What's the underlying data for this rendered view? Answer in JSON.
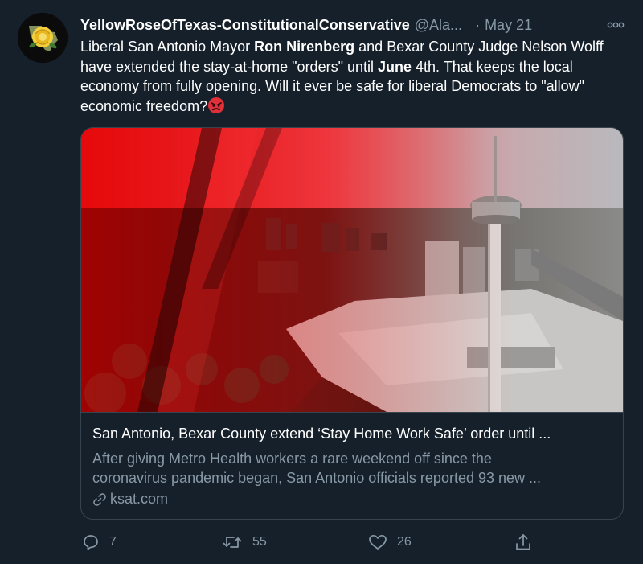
{
  "tweet": {
    "display_name": "YellowRoseOfTexas-ConstitutionalConservative",
    "handle": "@Ala...",
    "separator": "·",
    "date": "May 21",
    "text": {
      "p1": "Liberal San Antonio Mayor ",
      "b1": "Ron Nirenberg",
      "p2": " and Bexar County Judge Nelson Wolff have extended the stay-at-home \"orders\" until ",
      "b2": "June",
      "p3": " 4th.  That keeps the local economy from fully opening.  Will it ever be safe for liberal Democrats to \"allow\" economic freedom?"
    },
    "emoji": "angry-face-emoji"
  },
  "card": {
    "title": "San Antonio, Bexar County extend ‘Stay Home Work Safe’ order until ...",
    "description_line1": "After giving Metro Health workers a rare weekend off since the",
    "description_line2": "coronavirus pandemic began, San Antonio officials reported 93 new ...",
    "domain": "ksat.com"
  },
  "actions": {
    "reply_count": "7",
    "retweet_count": "55",
    "like_count": "26"
  },
  "colors": {
    "background": "#15202b",
    "secondary_text": "#8899a6",
    "border": "#38444d"
  }
}
